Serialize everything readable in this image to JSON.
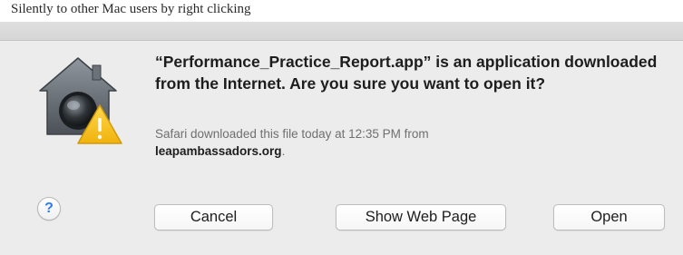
{
  "caption": "Silently to other Mac users by right clicking",
  "dialog": {
    "headline": "“Performance_Practice_Report.app” is an application downloaded from the Internet. Are you sure you want to open it?",
    "info_prefix": "Safari downloaded this file today at 12:35 PM from",
    "info_domain": "leapambassadors.org",
    "info_suffix": ".",
    "help_label": "?",
    "buttons": {
      "cancel": "Cancel",
      "show_web_page": "Show Web Page",
      "open": "Open"
    }
  },
  "icons": {
    "app_icon": "gatekeeper-house-warning-icon",
    "help": "help-icon"
  },
  "colors": {
    "dialog_bg": "#ececec",
    "help_accent": "#2d7cf6",
    "warning_yellow": "#f7c21b"
  }
}
